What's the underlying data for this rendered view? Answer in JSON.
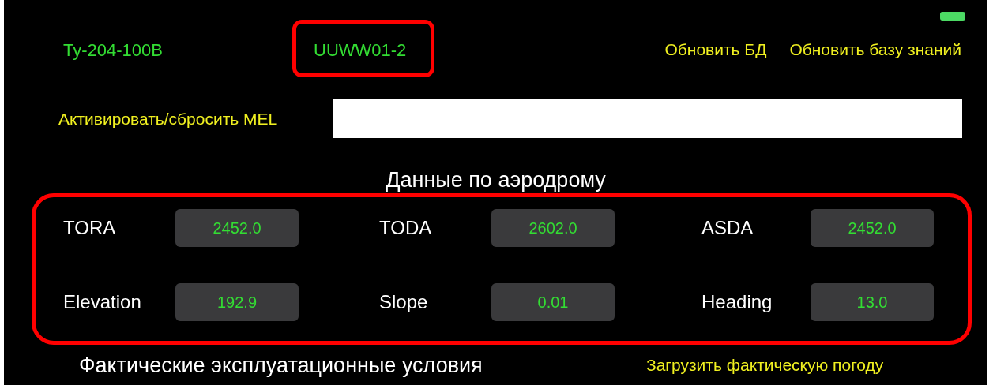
{
  "header": {
    "aircraft": "Ту-204-100В",
    "airport": "UUWW01-2",
    "links": [
      "Обновить БД",
      "Обновить базу знаний"
    ]
  },
  "mel": {
    "label": "Активировать/сбросить MEL"
  },
  "airport_data": {
    "title": "Данные по аэродрому",
    "fields": [
      {
        "label": "TORA",
        "value": "2452.0"
      },
      {
        "label": "TODA",
        "value": "2602.0"
      },
      {
        "label": "ASDA",
        "value": "2452.0"
      },
      {
        "label": "Elevation",
        "value": "192.9"
      },
      {
        "label": "Slope",
        "value": "0.01"
      },
      {
        "label": "Heading",
        "value": "13.0"
      }
    ]
  },
  "conditions": {
    "title": "Фактические эксплуатационные условия",
    "link": "Загрузить фактическую погоду"
  }
}
